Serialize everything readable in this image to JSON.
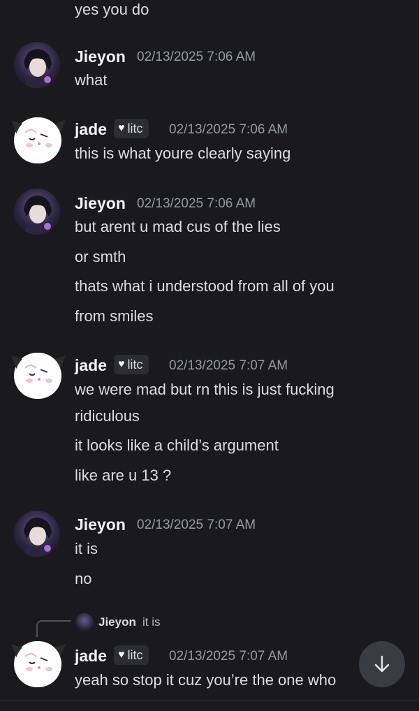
{
  "messages": {
    "m0": {
      "lines": [
        "yes you do"
      ]
    },
    "m1": {
      "author": "Jieyon",
      "timestamp": "02/13/2025 7:06 AM",
      "lines": [
        "what"
      ]
    },
    "m2": {
      "author": "jade",
      "tag": "litc",
      "timestamp": "02/13/2025 7:06 AM",
      "lines": [
        "this is what youre clearly saying"
      ]
    },
    "m3": {
      "author": "Jieyon",
      "timestamp": "02/13/2025 7:06 AM",
      "lines": [
        "but arent u mad cus of the lies",
        "or smth",
        "thats what i understood from all of you",
        "from smiles"
      ]
    },
    "m4": {
      "author": "jade",
      "tag": "litc",
      "timestamp": "02/13/2025 7:07 AM",
      "lines": [
        "we were mad but rn this is just fucking",
        "ridiculous",
        "it looks like a child’s argument",
        "like are u 13 ?"
      ]
    },
    "m5": {
      "author": "Jieyon",
      "timestamp": "02/13/2025 7:07 AM",
      "lines": [
        "it is",
        "no"
      ]
    },
    "m6": {
      "reply": {
        "author": "Jieyon",
        "text": "it is"
      },
      "author": "jade",
      "tag": "litc",
      "timestamp": "02/13/2025 7:07 AM",
      "lines": [
        "yeah so stop it cuz you’re the one who"
      ]
    }
  },
  "icons": {
    "jump_to_present": "arrow-down-icon",
    "role_tag": "heart-icon"
  },
  "colors": {
    "background": "#1a1a1e",
    "text": "#dbdee1",
    "timestamp": "#949ba4",
    "tag_bg": "#2b2d31",
    "fab_bg": "#3a3c43"
  }
}
